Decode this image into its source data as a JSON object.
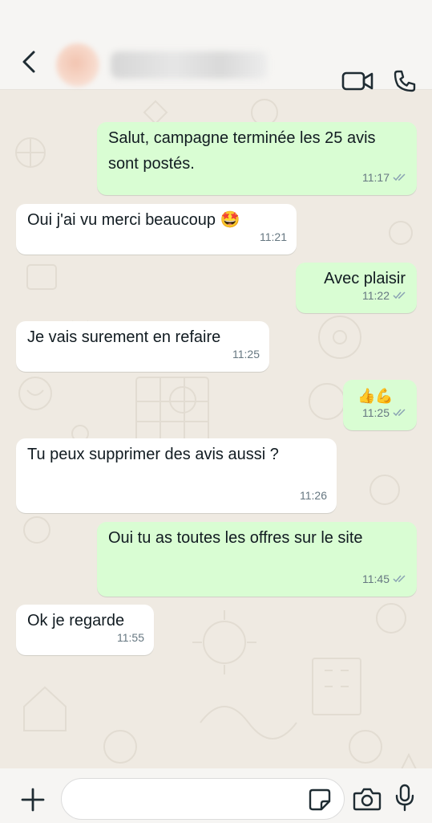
{
  "header": {
    "contact_name": "",
    "back_icon": "chevron-left-icon",
    "video_icon": "video-call-icon",
    "call_icon": "phone-call-icon"
  },
  "messages": [
    {
      "direction": "out",
      "text": "Salut, campagne terminée les 25 avis sont postés.",
      "time": "11:17",
      "status": "read"
    },
    {
      "direction": "in",
      "text": "Oui j'ai vu merci beaucoup 🤩",
      "time": "11:21"
    },
    {
      "direction": "out",
      "text": "Avec plaisir",
      "time": "11:22",
      "status": "read"
    },
    {
      "direction": "in",
      "text": "Je vais surement en refaire",
      "time": "11:25"
    },
    {
      "direction": "out",
      "text": "👍💪",
      "time": "11:25",
      "status": "read"
    },
    {
      "direction": "in",
      "text": "Tu peux supprimer des avis aussi ?",
      "time": "11:26"
    },
    {
      "direction": "out",
      "text": "Oui tu as toutes les offres sur le site",
      "time": "11:45",
      "status": "read"
    },
    {
      "direction": "in",
      "text": "Ok je regarde",
      "time": "11:55"
    }
  ],
  "composer": {
    "placeholder": "",
    "icons": [
      "plus-icon",
      "sticker-icon",
      "camera-icon",
      "microphone-icon"
    ]
  },
  "colors": {
    "outgoing_bubble": "#d9fdd3",
    "incoming_bubble": "#ffffff",
    "chat_background": "#efeae2",
    "read_ticks": "#7ea7c0"
  }
}
